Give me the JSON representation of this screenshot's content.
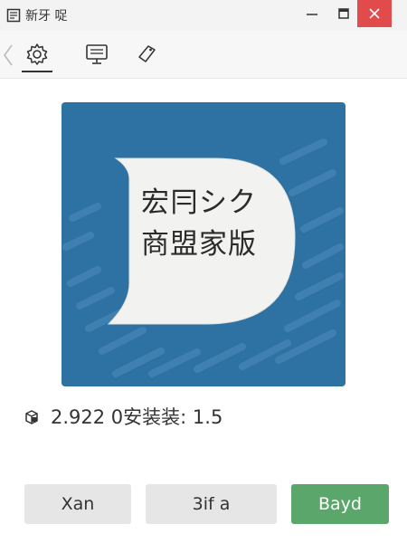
{
  "window": {
    "title": "新牙 哫",
    "app_icon": "document-icon",
    "controls": [
      "minimize-icon",
      "maximize-icon",
      "close-icon"
    ]
  },
  "toolbar": {
    "tabs": [
      {
        "icon": "gear-icon",
        "active": true
      },
      {
        "icon": "monitor-icon",
        "active": false
      },
      {
        "icon": "tag-icon",
        "active": false
      }
    ]
  },
  "cover": {
    "title_line1": "宏冃シク",
    "title_line2": "商盟家版",
    "background_color": "#2e72a3"
  },
  "info": {
    "icon": "package-icon",
    "text": "2.922 0安装装: 1.5"
  },
  "buttons": {
    "first": "Xan",
    "second": "3if a",
    "primary": "Bayd",
    "primary_color": "#5ba66a"
  }
}
